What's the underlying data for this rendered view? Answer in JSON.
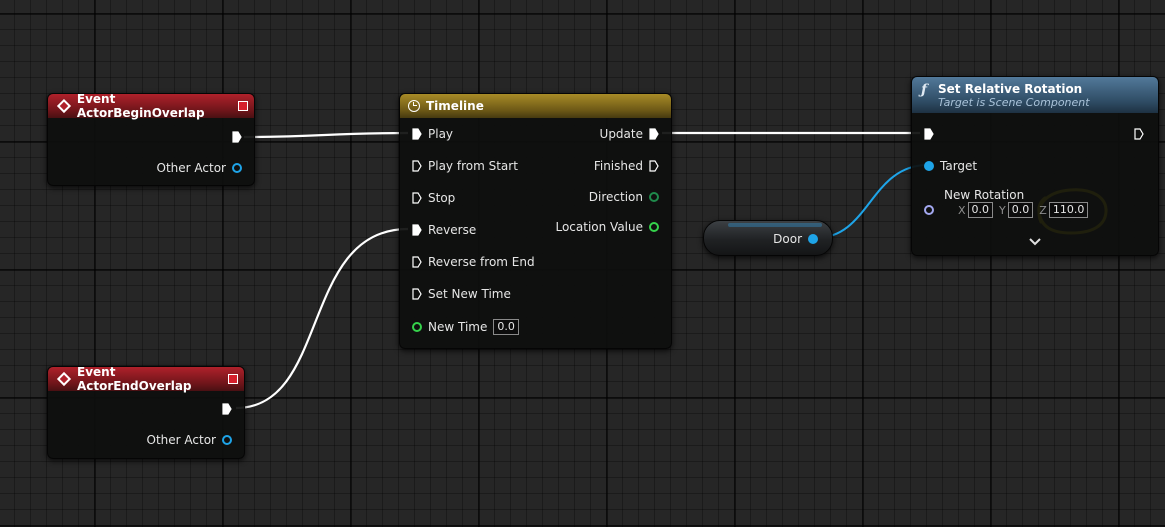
{
  "nodes": {
    "begin_overlap": {
      "title": "Event ActorBeginOverlap",
      "other_actor_label": "Other Actor"
    },
    "end_overlap": {
      "title": "Event ActorEndOverlap",
      "other_actor_label": "Other Actor"
    },
    "timeline": {
      "title": "Timeline",
      "inputs": [
        "Play",
        "Play from Start",
        "Stop",
        "Reverse",
        "Reverse from End",
        "Set New Time"
      ],
      "new_time_label": "New Time",
      "new_time_value": "0.0",
      "outputs": {
        "update": "Update",
        "finished": "Finished",
        "direction": "Direction",
        "location_value": "Location Value"
      }
    },
    "set_rotation": {
      "title": "Set Relative Rotation",
      "subtitle": "Target is Scene Component",
      "target_label": "Target",
      "new_rotation_label": "New Rotation",
      "axes": {
        "x_label": "X",
        "x_value": "0.0",
        "y_label": "Y",
        "y_value": "0.0",
        "z_label": "Z",
        "z_value": "110.0"
      },
      "expand_icon": "chevron-down-icon"
    },
    "door_var": {
      "label": "Door"
    }
  },
  "colors": {
    "event_header": "#b0212b",
    "timeline_header": "#a88b27",
    "function_header": "#52799a",
    "exec_wire": "#ffffff",
    "object_pin": "#1ea4e8",
    "float_pin": "#35d24b",
    "highlight_annotation": "#ffe600"
  }
}
